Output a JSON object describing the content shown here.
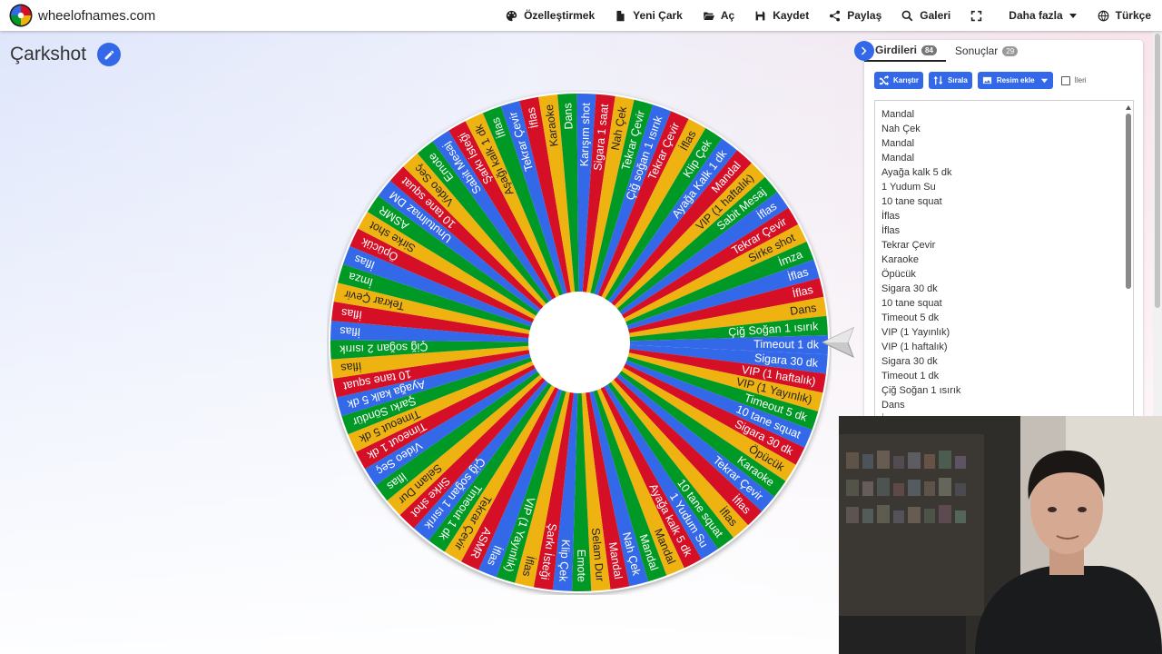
{
  "app": {
    "site_name": "wheelofnames.com"
  },
  "nav": {
    "customize": "Özelleştirmek",
    "new_wheel": "Yeni Çark",
    "open": "Aç",
    "save": "Kaydet",
    "share": "Paylaş",
    "gallery": "Galeri",
    "more": "Daha fazla",
    "language": "Türkçe"
  },
  "wheel": {
    "title": "Çarkshot",
    "colors": [
      "#3369e8",
      "#d50f25",
      "#eeb211",
      "#009925"
    ],
    "segment_labels": [
      "Sigara 30 dk",
      "VIP (1 haftalık)",
      "VIP (1 Yayınlık)",
      "Timeout 5 dk",
      "10 tane squat",
      "Sigara 30 dk",
      "Öpücük",
      "Karaoke",
      "Tekrar Çevir",
      "İflas",
      "İflas",
      "10 tane squat",
      "1 Yudum Su",
      "Ayağa kalk 5 dk",
      "Mandal",
      "Mandal",
      "Nah Çek",
      "Mandal",
      "Selam Dur",
      "Emote",
      "Klip Çek",
      "Şarkı İsteği",
      "İflas",
      "VIP (1 Yayınlık)",
      "İflas",
      "ASMR",
      "Tekrar Çevir",
      "Timeout 1 dk",
      "Çiğ soğan 1 ısırık",
      "Sirke shot",
      "Selam Dur",
      "İflas",
      "Video Seç",
      "Timeout 1 dk",
      "Timeout 5 dk",
      "Şarkı Söndür",
      "Ayağa kalk 5 dk",
      "10 tane squat",
      "İflas",
      "Çiğ soğan 2 ısırık",
      "İflas",
      "İflas",
      "Tekrar Çevir",
      "İmza",
      "İflas",
      "Öpücük",
      "Sirke shot",
      "ASMR",
      "Unutulmaz DM",
      "10 tane squat",
      "Video Seç",
      "Emote",
      "Sabit Mesaj",
      "Şarkı İsteği",
      "Aşağı kalk 1 dk",
      "İflas",
      "Tekrar Çevir",
      "İflas",
      "Karaoke",
      "Dans",
      "Karışım shot",
      "Sigara 1 saat",
      "Nah Çek",
      "Tekrar Çevir",
      "Çiğ soğan 1 ısırık",
      "Tekrar Çevir",
      "İflas",
      "Klip Çek",
      "Ayağa Kalk 1 dk",
      "Mandal",
      "VIP (1 haftalık)",
      "Sabit Mesaj",
      "İflas",
      "Tekrar Çevir",
      "Sirke shot",
      "İmza",
      "İflas",
      "İflas",
      "Dans",
      "Çiğ Soğan 1 ısırık",
      "Timeout 1 dk"
    ]
  },
  "panel": {
    "tab_entries": "Girdileri",
    "entries_count": "84",
    "tab_results": "Sonuçlar",
    "results_count": "29",
    "shuffle": "Karıştır",
    "sort": "Sırala",
    "add_image": "Resim ekle",
    "advanced": "İleri",
    "entries": [
      "Mandal",
      "Nah Çek",
      "Mandal",
      "Mandal",
      "Ayağa kalk 5 dk",
      "1 Yudum Su",
      "10 tane squat",
      "İflas",
      "İflas",
      "Tekrar Çevir",
      "Karaoke",
      "Öpücük",
      "Sigara 30 dk",
      "10 tane squat",
      "Timeout 5 dk",
      "VIP (1 Yayınlık)",
      "VIP (1 haftalık)",
      "Sigara 30 dk",
      "Timeout 1 dk",
      "Çiğ Soğan 1 ısırık",
      "Dans",
      "İ"
    ]
  }
}
